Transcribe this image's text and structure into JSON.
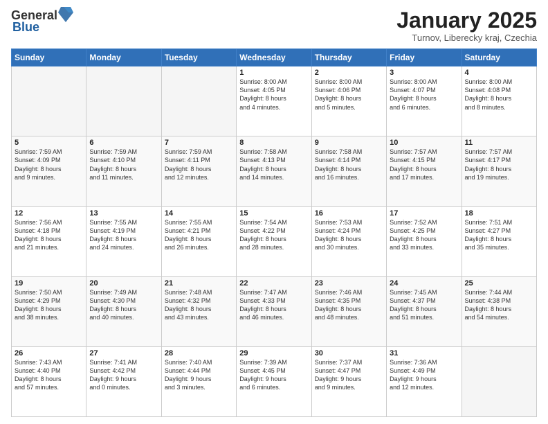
{
  "header": {
    "logo_general": "General",
    "logo_blue": "Blue",
    "month_title": "January 2025",
    "location": "Turnov, Liberecky kraj, Czechia"
  },
  "weekdays": [
    "Sunday",
    "Monday",
    "Tuesday",
    "Wednesday",
    "Thursday",
    "Friday",
    "Saturday"
  ],
  "weeks": [
    [
      {
        "day": "",
        "info": ""
      },
      {
        "day": "",
        "info": ""
      },
      {
        "day": "",
        "info": ""
      },
      {
        "day": "1",
        "info": "Sunrise: 8:00 AM\nSunset: 4:05 PM\nDaylight: 8 hours\nand 4 minutes."
      },
      {
        "day": "2",
        "info": "Sunrise: 8:00 AM\nSunset: 4:06 PM\nDaylight: 8 hours\nand 5 minutes."
      },
      {
        "day": "3",
        "info": "Sunrise: 8:00 AM\nSunset: 4:07 PM\nDaylight: 8 hours\nand 6 minutes."
      },
      {
        "day": "4",
        "info": "Sunrise: 8:00 AM\nSunset: 4:08 PM\nDaylight: 8 hours\nand 8 minutes."
      }
    ],
    [
      {
        "day": "5",
        "info": "Sunrise: 7:59 AM\nSunset: 4:09 PM\nDaylight: 8 hours\nand 9 minutes."
      },
      {
        "day": "6",
        "info": "Sunrise: 7:59 AM\nSunset: 4:10 PM\nDaylight: 8 hours\nand 11 minutes."
      },
      {
        "day": "7",
        "info": "Sunrise: 7:59 AM\nSunset: 4:11 PM\nDaylight: 8 hours\nand 12 minutes."
      },
      {
        "day": "8",
        "info": "Sunrise: 7:58 AM\nSunset: 4:13 PM\nDaylight: 8 hours\nand 14 minutes."
      },
      {
        "day": "9",
        "info": "Sunrise: 7:58 AM\nSunset: 4:14 PM\nDaylight: 8 hours\nand 16 minutes."
      },
      {
        "day": "10",
        "info": "Sunrise: 7:57 AM\nSunset: 4:15 PM\nDaylight: 8 hours\nand 17 minutes."
      },
      {
        "day": "11",
        "info": "Sunrise: 7:57 AM\nSunset: 4:17 PM\nDaylight: 8 hours\nand 19 minutes."
      }
    ],
    [
      {
        "day": "12",
        "info": "Sunrise: 7:56 AM\nSunset: 4:18 PM\nDaylight: 8 hours\nand 21 minutes."
      },
      {
        "day": "13",
        "info": "Sunrise: 7:55 AM\nSunset: 4:19 PM\nDaylight: 8 hours\nand 24 minutes."
      },
      {
        "day": "14",
        "info": "Sunrise: 7:55 AM\nSunset: 4:21 PM\nDaylight: 8 hours\nand 26 minutes."
      },
      {
        "day": "15",
        "info": "Sunrise: 7:54 AM\nSunset: 4:22 PM\nDaylight: 8 hours\nand 28 minutes."
      },
      {
        "day": "16",
        "info": "Sunrise: 7:53 AM\nSunset: 4:24 PM\nDaylight: 8 hours\nand 30 minutes."
      },
      {
        "day": "17",
        "info": "Sunrise: 7:52 AM\nSunset: 4:25 PM\nDaylight: 8 hours\nand 33 minutes."
      },
      {
        "day": "18",
        "info": "Sunrise: 7:51 AM\nSunset: 4:27 PM\nDaylight: 8 hours\nand 35 minutes."
      }
    ],
    [
      {
        "day": "19",
        "info": "Sunrise: 7:50 AM\nSunset: 4:29 PM\nDaylight: 8 hours\nand 38 minutes."
      },
      {
        "day": "20",
        "info": "Sunrise: 7:49 AM\nSunset: 4:30 PM\nDaylight: 8 hours\nand 40 minutes."
      },
      {
        "day": "21",
        "info": "Sunrise: 7:48 AM\nSunset: 4:32 PM\nDaylight: 8 hours\nand 43 minutes."
      },
      {
        "day": "22",
        "info": "Sunrise: 7:47 AM\nSunset: 4:33 PM\nDaylight: 8 hours\nand 46 minutes."
      },
      {
        "day": "23",
        "info": "Sunrise: 7:46 AM\nSunset: 4:35 PM\nDaylight: 8 hours\nand 48 minutes."
      },
      {
        "day": "24",
        "info": "Sunrise: 7:45 AM\nSunset: 4:37 PM\nDaylight: 8 hours\nand 51 minutes."
      },
      {
        "day": "25",
        "info": "Sunrise: 7:44 AM\nSunset: 4:38 PM\nDaylight: 8 hours\nand 54 minutes."
      }
    ],
    [
      {
        "day": "26",
        "info": "Sunrise: 7:43 AM\nSunset: 4:40 PM\nDaylight: 8 hours\nand 57 minutes."
      },
      {
        "day": "27",
        "info": "Sunrise: 7:41 AM\nSunset: 4:42 PM\nDaylight: 9 hours\nand 0 minutes."
      },
      {
        "day": "28",
        "info": "Sunrise: 7:40 AM\nSunset: 4:44 PM\nDaylight: 9 hours\nand 3 minutes."
      },
      {
        "day": "29",
        "info": "Sunrise: 7:39 AM\nSunset: 4:45 PM\nDaylight: 9 hours\nand 6 minutes."
      },
      {
        "day": "30",
        "info": "Sunrise: 7:37 AM\nSunset: 4:47 PM\nDaylight: 9 hours\nand 9 minutes."
      },
      {
        "day": "31",
        "info": "Sunrise: 7:36 AM\nSunset: 4:49 PM\nDaylight: 9 hours\nand 12 minutes."
      },
      {
        "day": "",
        "info": ""
      }
    ]
  ]
}
